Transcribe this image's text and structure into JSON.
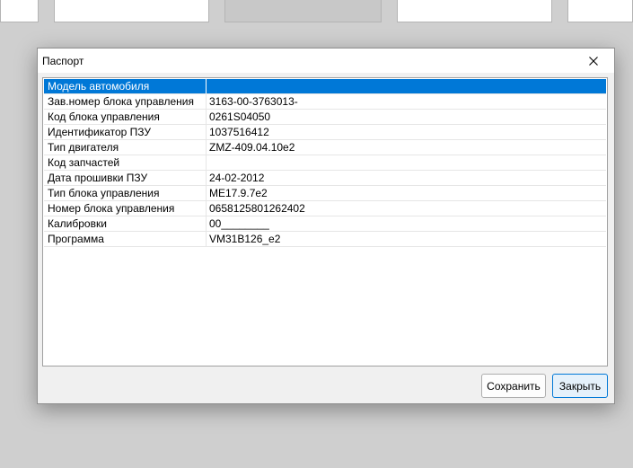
{
  "dialog": {
    "title": "Паспорт",
    "rows": [
      {
        "label": "Модель автомобиля",
        "value": ""
      },
      {
        "label": "Зав.номер блока управления",
        "value": "3163-00-3763013-"
      },
      {
        "label": "Код блока управления",
        "value": "0261S04050"
      },
      {
        "label": "Идентификатор ПЗУ",
        "value": "1037516412"
      },
      {
        "label": "Тип двигателя",
        "value": "ZMZ-409.04.10e2"
      },
      {
        "label": "Код запчастей",
        "value": ""
      },
      {
        "label": "Дата прошивки ПЗУ",
        "value": "24-02-2012"
      },
      {
        "label": "Тип блока управления",
        "value": "ME17.9.7e2"
      },
      {
        "label": "Номер блока управления",
        "value": "0658125801262402"
      },
      {
        "label": "Калибровки",
        "value": "00________"
      },
      {
        "label": "Программа",
        "value": "VM31B126_e2"
      }
    ],
    "save_label": "Сохранить",
    "close_label": "Закрыть"
  },
  "colors": {
    "selection": "#0078d7",
    "dialog_bg": "#f0f0f0"
  },
  "icons": {
    "close": "close-icon"
  }
}
